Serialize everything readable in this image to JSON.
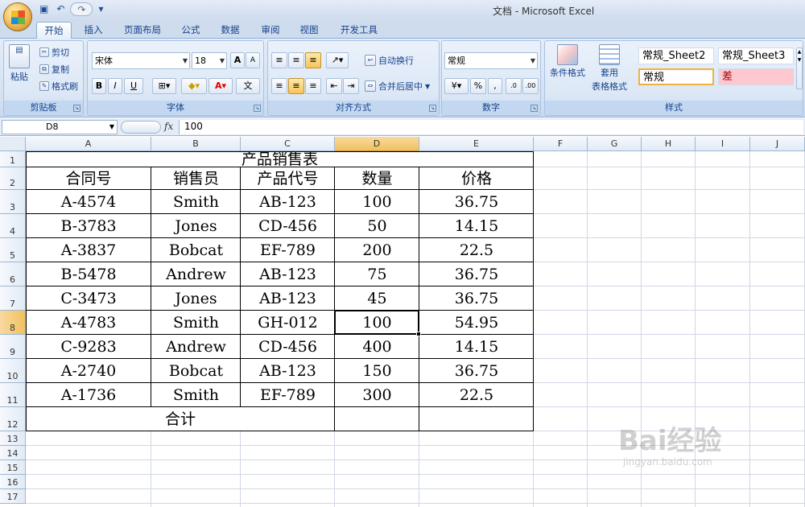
{
  "window": {
    "title": "文档 - Microsoft Excel"
  },
  "qat": {
    "undo": "↶",
    "redo": "↷",
    "customize": "▾"
  },
  "tabs": [
    "开始",
    "插入",
    "页面布局",
    "公式",
    "数据",
    "审阅",
    "视图",
    "开发工具"
  ],
  "active_tab": "开始",
  "ribbon": {
    "clipboard": {
      "paste": "粘贴",
      "cut": "剪切",
      "copy": "复制",
      "format_painter": "格式刷",
      "label": "剪贴板"
    },
    "font": {
      "name": "宋体",
      "size": "18",
      "bold": "B",
      "italic": "I",
      "underline": "U",
      "label": "字体",
      "grow": "A",
      "shrink": "A",
      "wen": "文"
    },
    "alignment": {
      "wrap": "自动换行",
      "merge": "合并后居中",
      "label": "对齐方式"
    },
    "number": {
      "format": "常规",
      "percent": "%",
      "comma": ",",
      "inc_dec": ".0",
      "dec_dec": ".00",
      "label": "数字"
    },
    "styles": {
      "conditional": "条件格式",
      "table_format": "套用",
      "table_format2": "表格格式",
      "cell1": "常规_Sheet2",
      "cell2": "常规_Sheet3",
      "cell3": "常规",
      "cell4": "差",
      "label": "样式"
    }
  },
  "formula_bar": {
    "name_box": "D8",
    "fx": "fx",
    "value": "100"
  },
  "columns": [
    "A",
    "B",
    "C",
    "D",
    "E",
    "F",
    "G",
    "H",
    "I",
    "J"
  ],
  "rows": [
    "1",
    "2",
    "3",
    "4",
    "5",
    "6",
    "7",
    "8",
    "9",
    "10",
    "11",
    "12",
    "13",
    "14",
    "15",
    "16",
    "17"
  ],
  "sheet": {
    "title": "产品销售表",
    "headers": [
      "合同号",
      "销售员",
      "产品代号",
      "数量",
      "价格"
    ],
    "rows": [
      [
        "A-4574",
        "Smith",
        "AB-123",
        "100",
        "36.75"
      ],
      [
        "B-3783",
        "Jones",
        "CD-456",
        "50",
        "14.15"
      ],
      [
        "A-3837",
        "Bobcat",
        "EF-789",
        "200",
        "22.5"
      ],
      [
        "B-5478",
        "Andrew",
        "AB-123",
        "75",
        "36.75"
      ],
      [
        "C-3473",
        "Jones",
        "AB-123",
        "45",
        "36.75"
      ],
      [
        "A-4783",
        "Smith",
        "GH-012",
        "100",
        "54.95"
      ],
      [
        "C-9283",
        "Andrew",
        "CD-456",
        "400",
        "14.15"
      ],
      [
        "A-2740",
        "Bobcat",
        "AB-123",
        "150",
        "36.75"
      ],
      [
        "A-1736",
        "Smith",
        "EF-789",
        "300",
        "22.5"
      ]
    ],
    "total_label": "合计"
  },
  "watermark": {
    "text": "Bai经验",
    "url": "jingyan.baidu.com"
  }
}
